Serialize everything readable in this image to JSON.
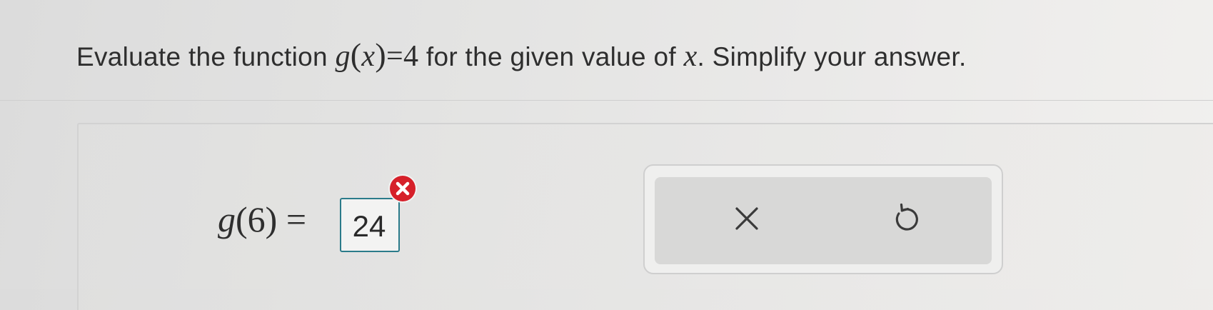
{
  "question": {
    "prefix": "Evaluate the function ",
    "function_name": "g",
    "variable": "x",
    "equals": "=",
    "function_value": "4",
    "middle": " for the given value of ",
    "suffix": ". Simplify your answer."
  },
  "equation": {
    "function_name": "g",
    "argument": "6",
    "equals": "="
  },
  "answer": {
    "value": "24",
    "status": "incorrect",
    "status_icon": "error-x-icon",
    "status_color": "#d6202a",
    "border_color": "#2b7b8a"
  },
  "toolbar": {
    "clear_icon": "clear-x-icon",
    "undo_icon": "undo-icon"
  }
}
